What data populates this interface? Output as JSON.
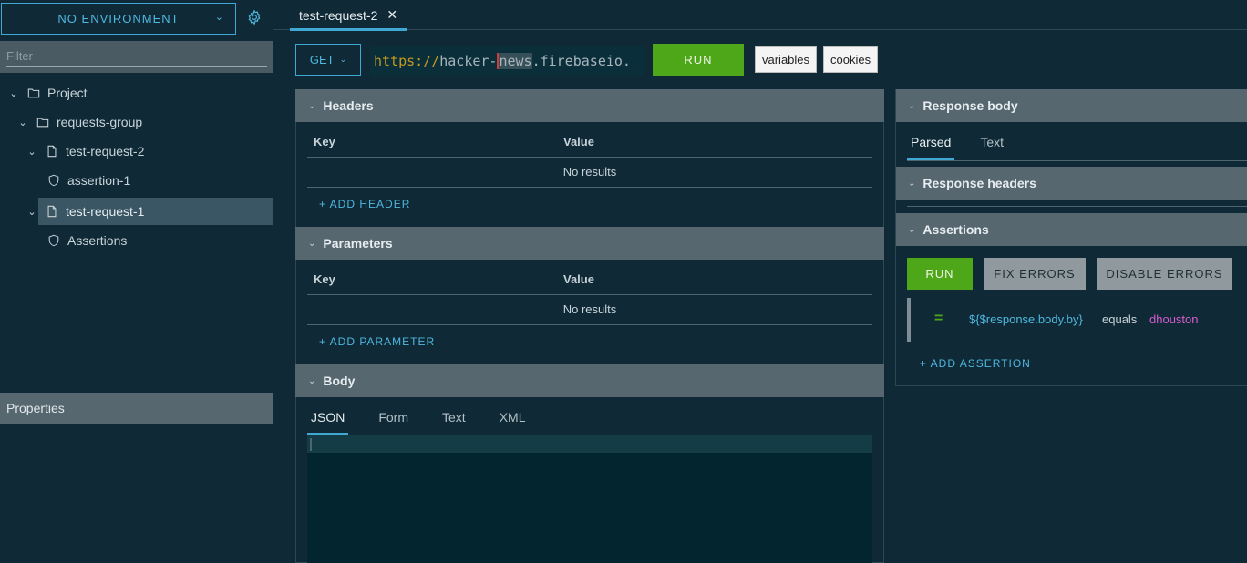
{
  "sidebar": {
    "environment": "NO ENVIRONMENT",
    "filter_placeholder": "Filter",
    "tree": {
      "project": "Project",
      "group": "requests-group",
      "request2": "test-request-2",
      "assertion1": "assertion-1",
      "request1": "test-request-1",
      "assertions": "Assertions"
    },
    "properties": "Properties"
  },
  "tabs": {
    "active": "test-request-2"
  },
  "request": {
    "method": "GET",
    "url_proto": "https://",
    "url_pre": "hacker-",
    "url_hl": "news",
    "url_post": ".firebaseio.",
    "run": "RUN",
    "variables": "variables",
    "cookies": "cookies"
  },
  "headers": {
    "title": "Headers",
    "key_col": "Key",
    "value_col": "Value",
    "empty": "No results",
    "add": "+ ADD HEADER"
  },
  "parameters": {
    "title": "Parameters",
    "key_col": "Key",
    "value_col": "Value",
    "empty": "No results",
    "add": "+ ADD PARAMETER"
  },
  "body": {
    "title": "Body",
    "tabs": [
      "JSON",
      "Form",
      "Text",
      "XML"
    ]
  },
  "response": {
    "body_title": "Response body",
    "tabs": [
      "Parsed",
      "Text"
    ],
    "headers_title": "Response headers",
    "assertions_title": "Assertions",
    "run": "RUN",
    "fix": "FIX ERRORS",
    "disable": "DISABLE ERRORS",
    "assertion": {
      "operator_symbol": "=",
      "path": "${$response.body.by}",
      "operator": "equals",
      "value": "dhouston"
    },
    "add": "+ ADD ASSERTION"
  },
  "colors": {
    "accent": "#3fa9d3",
    "run": "#4ea619",
    "assertion_value": "#d45ccf"
  }
}
